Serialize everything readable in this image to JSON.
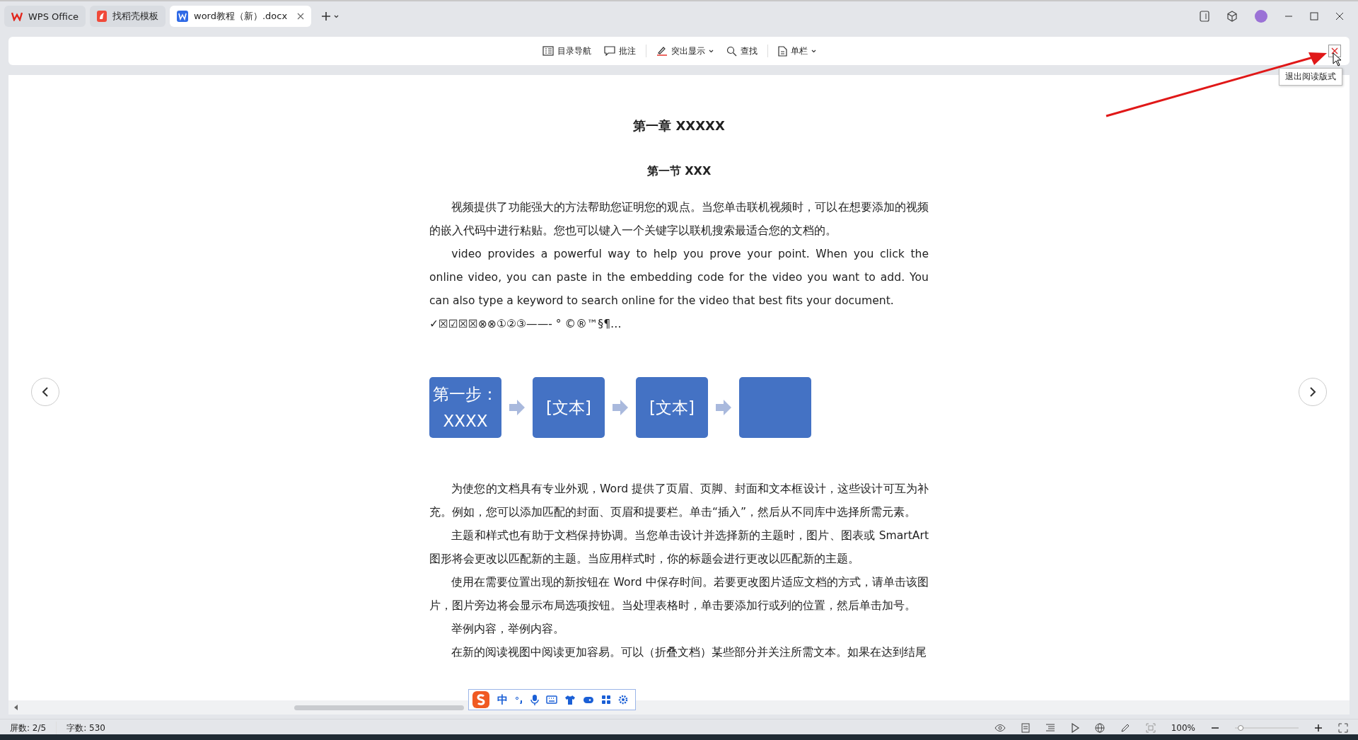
{
  "tabs": [
    {
      "label": "WPS Office",
      "kind": "wps",
      "selected": false
    },
    {
      "label": "找稻壳模板",
      "kind": "template",
      "selected": false
    },
    {
      "label": "word教程（新）.docx",
      "kind": "doc",
      "selected": true
    }
  ],
  "toolbar": [
    {
      "label": "目录导航",
      "kind": "toc",
      "dropdown": false
    },
    {
      "label": "批注",
      "kind": "comment",
      "dropdown": false
    },
    {
      "label": "突出显示",
      "kind": "highlight",
      "dropdown": true
    },
    {
      "label": "查找",
      "kind": "search",
      "dropdown": false
    },
    {
      "label": "单栏",
      "kind": "page",
      "dropdown": true
    }
  ],
  "tooltip": "退出阅读版式",
  "document": {
    "chapter_title": "第一章  XXXXX",
    "section_title": "第一节  XXX",
    "paragraphs": [
      {
        "text": "视频提供了功能强大的方法帮助您证明您的观点。当您单击联机视频时，可以在想要添加的视频的嵌入代码中进行粘贴。您也可以键入一个关键字以联机搜索最适合您的文档的。",
        "indent": true
      },
      {
        "text": "video provides a powerful way to help you prove your point. When you click the online video, you can paste in the embedding code for the video you want to add. You can also type a keyword to search online for the video that best fits your document.",
        "indent": true
      },
      {
        "text": "✓☒☑☒☒⊗⊗①②③——-     °  ©®™§¶…",
        "indent": false
      }
    ],
    "smartart": [
      {
        "kind": "text",
        "text": "第一步：XXXX"
      },
      {
        "kind": "text",
        "text": "[文本]"
      },
      {
        "kind": "text",
        "text": "[文本]"
      },
      {
        "kind": "blank"
      }
    ],
    "paragraphs_after": [
      {
        "text": "为使您的文档具有专业外观，Word 提供了页眉、页脚、封面和文本框设计，这些设计可互为补充。例如，您可以添加匹配的封面、页眉和提要栏。单击“插入”，然后从不同库中选择所需元素。",
        "indent": true
      },
      {
        "text": "主题和样式也有助于文档保持协调。当您单击设计并选择新的主题时，图片、图表或 SmartArt 图形将会更改以匹配新的主题。当应用样式时，你的标题会进行更改以匹配新的主题。",
        "indent": true
      },
      {
        "text": "使用在需要位置出现的新按钮在 Word 中保存时间。若要更改图片适应文档的方式，请单击该图片，图片旁边将会显示布局选项按钮。当处理表格时，单击要添加行或列的位置，然后单击加号。",
        "indent": true
      },
      {
        "text": "举例内容，举例内容。",
        "indent": true
      },
      {
        "text": "在新的阅读视图中阅读更加容易。可以（折叠文档）某些部分并关注所需文本。如果在达到结尾",
        "indent": true
      }
    ]
  },
  "ime": {
    "label": "中"
  },
  "status_bar": {
    "pages": "屏数: 2/5",
    "words": "字数: 530",
    "zoom": "100%",
    "zoom_slider": {
      "level": 0.05
    }
  }
}
